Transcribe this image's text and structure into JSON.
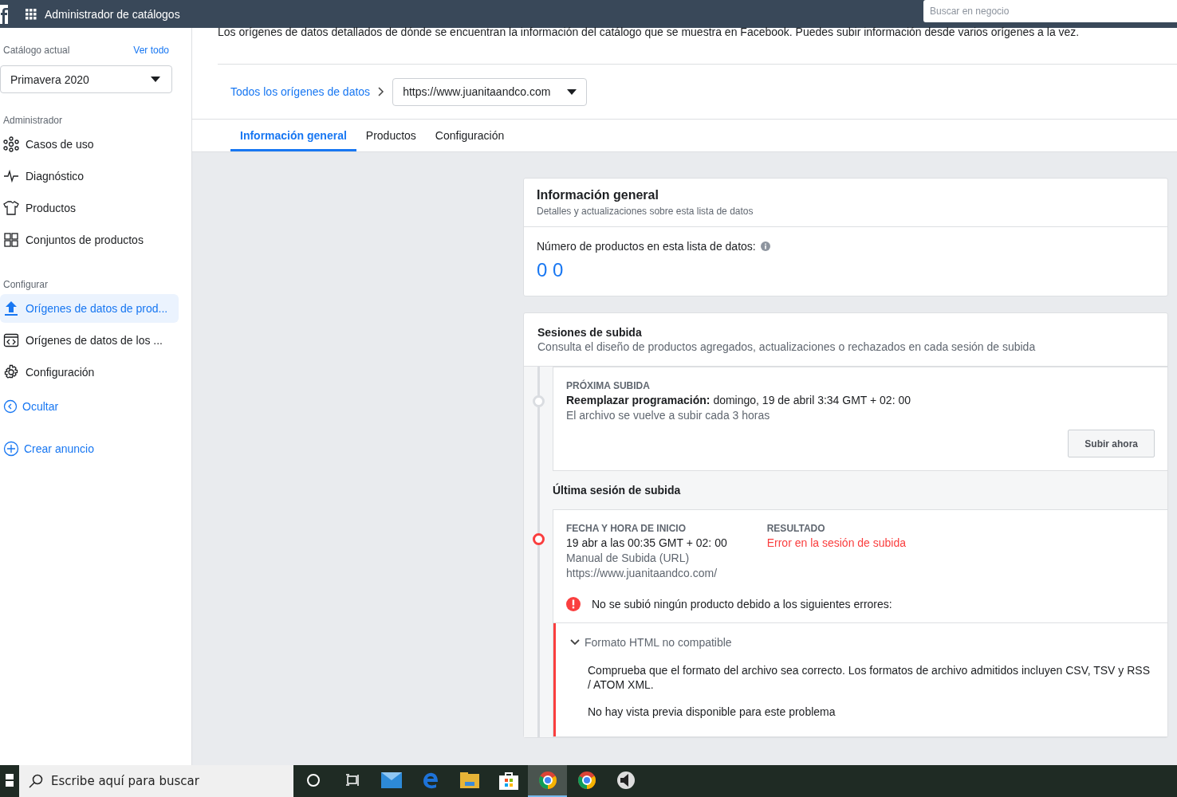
{
  "topbar": {
    "title": "Administrador de catálogos",
    "search": {
      "placeholder": "Buscar en negocio"
    }
  },
  "sidebar": {
    "catalog_label": "Catálogo actual",
    "see_all": "Ver todo",
    "catalog": "Primavera 2020",
    "sections": [
      {
        "title": "Administrador",
        "items": [
          {
            "kind": "network",
            "label": "Casos de uso",
            "selected": false
          },
          {
            "kind": "pulse",
            "label": "Diagnóstico",
            "selected": false
          },
          {
            "kind": "shirt",
            "label": "Productos",
            "selected": false
          },
          {
            "kind": "grid",
            "label": "Conjuntos de productos",
            "selected": false
          }
        ]
      },
      {
        "title": "Configurar",
        "items": [
          {
            "kind": "upload",
            "label": "Orígenes de datos de prod...",
            "selected": true
          },
          {
            "kind": "code",
            "label": "Orígenes de datos de los ...",
            "selected": false
          },
          {
            "kind": "gear",
            "label": "Configuración",
            "selected": false
          }
        ]
      }
    ],
    "hide": "Ocultar",
    "create_ad": "Crear anuncio"
  },
  "intro": "Los orígenes de datos detallados de dónde se encuentran la información del catálogo que se muestra en Facebook. Puedes subir información desde varios orígenes a la vez.",
  "breadcrumb": {
    "link": "Todos los orígenes de datos",
    "source": "https://www.juanitaandco.com"
  },
  "tabs": [
    {
      "label": "Información general",
      "selected": true
    },
    {
      "label": "Productos",
      "selected": false
    },
    {
      "label": "Configuración",
      "selected": false
    }
  ],
  "overview": {
    "title": "Información general",
    "subtitle": "Detalles y actualizaciones sobre esta lista de datos",
    "count_label": "Número de productos en esta lista de datos:",
    "count": "0 0"
  },
  "sessions": {
    "title": "Sesiones de subida",
    "subtitle": "Consulta el diseño de productos agregados, actualizaciones o rechazados en cada sesión de subida",
    "next": {
      "heading": "PRÓXIMA SUBIDA",
      "schedule": "**Reemplazar programación:** domingo, 19 de abril 3:34 GMT + 02: 00",
      "repeat": "El archivo se vuelve a subir cada 3 horas",
      "button": "Subir ahora"
    },
    "last": {
      "title": "Última sesión de subida",
      "start_heading": "FECHA Y HORA DE INICIO",
      "start": "19 abr a las 00:35 GMT + 02: 00",
      "method": "Manual de Subida (URL)",
      "url": "https://www.juanitaandco.com/",
      "result_heading": "RESULTADO",
      "result": "Error en la sesión de subida",
      "failed": true,
      "error_summary": "No se subió ningún producto debido a los siguientes errores:",
      "errors": [
        {
          "title": "Formato HTML no compatible",
          "expanded": true,
          "body": "Comprueba que el formato del archivo sea correcto. Los formatos de archivo admitidos incluyen CSV, TSV y RSS / ATOM XML.",
          "note": "No hay vista previa disponible para este problema"
        }
      ]
    }
  },
  "taskbar": {
    "search": {
      "placeholder": "Escribe aquí para buscar"
    },
    "apps": [
      {
        "kind": "cortana",
        "selected": false
      },
      {
        "kind": "taskview",
        "selected": false
      },
      {
        "kind": "mail",
        "selected": false
      },
      {
        "kind": "edge",
        "selected": false
      },
      {
        "kind": "folder",
        "selected": false
      },
      {
        "kind": "store",
        "selected": false
      },
      {
        "kind": "chrome",
        "selected": true
      },
      {
        "kind": "chrome",
        "selected": false
      },
      {
        "kind": "speaker",
        "selected": false
      }
    ]
  }
}
